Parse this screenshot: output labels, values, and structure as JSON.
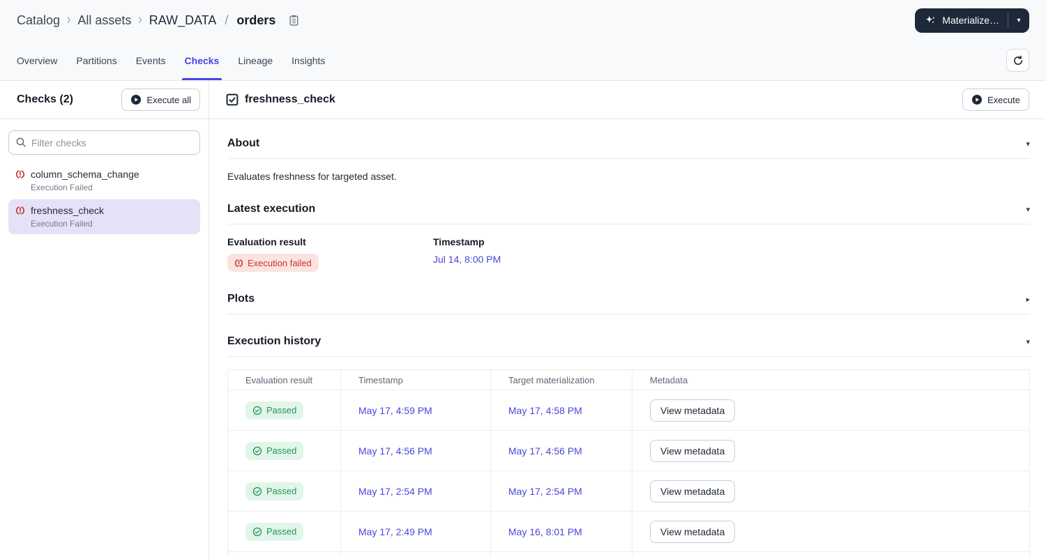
{
  "breadcrumb": {
    "catalog": "Catalog",
    "all_assets": "All assets",
    "asset_group": "RAW_DATA",
    "separator": "/",
    "asset_name": "orders"
  },
  "materialize_button": {
    "label": "Materialize…"
  },
  "tabs": [
    {
      "label": "Overview"
    },
    {
      "label": "Partitions"
    },
    {
      "label": "Events"
    },
    {
      "label": "Checks",
      "active": true
    },
    {
      "label": "Lineage"
    },
    {
      "label": "Insights"
    }
  ],
  "sidebar": {
    "title": "Checks (2)",
    "execute_all_label": "Execute all",
    "filter_placeholder": "Filter checks",
    "items": [
      {
        "name": "column_schema_change",
        "status": "Execution Failed"
      },
      {
        "name": "freshness_check",
        "status": "Execution Failed",
        "selected": true
      }
    ]
  },
  "main": {
    "title": "freshness_check",
    "execute_label": "Execute",
    "about": {
      "title": "About",
      "description": "Evaluates freshness for targeted asset."
    },
    "latest_execution": {
      "title": "Latest execution",
      "evaluation_result_label": "Evaluation result",
      "evaluation_result": "Execution failed",
      "timestamp_label": "Timestamp",
      "timestamp": "Jul 14, 8:00 PM"
    },
    "plots": {
      "title": "Plots"
    },
    "execution_history": {
      "title": "Execution history",
      "columns": [
        "Evaluation result",
        "Timestamp",
        "Target materialization",
        "Metadata"
      ],
      "rows": [
        {
          "result": "Passed",
          "timestamp": "May 17, 4:59 PM",
          "target_materialization": "May 17, 4:58 PM",
          "metadata_label": "View metadata"
        },
        {
          "result": "Passed",
          "timestamp": "May 17, 4:56 PM",
          "target_materialization": "May 17, 4:56 PM",
          "metadata_label": "View metadata"
        },
        {
          "result": "Passed",
          "timestamp": "May 17, 2:54 PM",
          "target_materialization": "May 17, 2:54 PM",
          "metadata_label": "View metadata"
        },
        {
          "result": "Passed",
          "timestamp": "May 17, 2:49 PM",
          "target_materialization": "May 16, 8:01 PM",
          "metadata_label": "View metadata"
        }
      ]
    }
  },
  "colors": {
    "accent": "#4745e0",
    "link": "#4a46d8",
    "error_text": "#c5362c",
    "error_bg": "#fbe3e0",
    "success_text": "#219559",
    "success_bg": "#e1f5e9",
    "dark_button_bg": "#1d2838",
    "selected_item_bg": "#e5e2f8",
    "header_bg": "#f8f9fb"
  }
}
